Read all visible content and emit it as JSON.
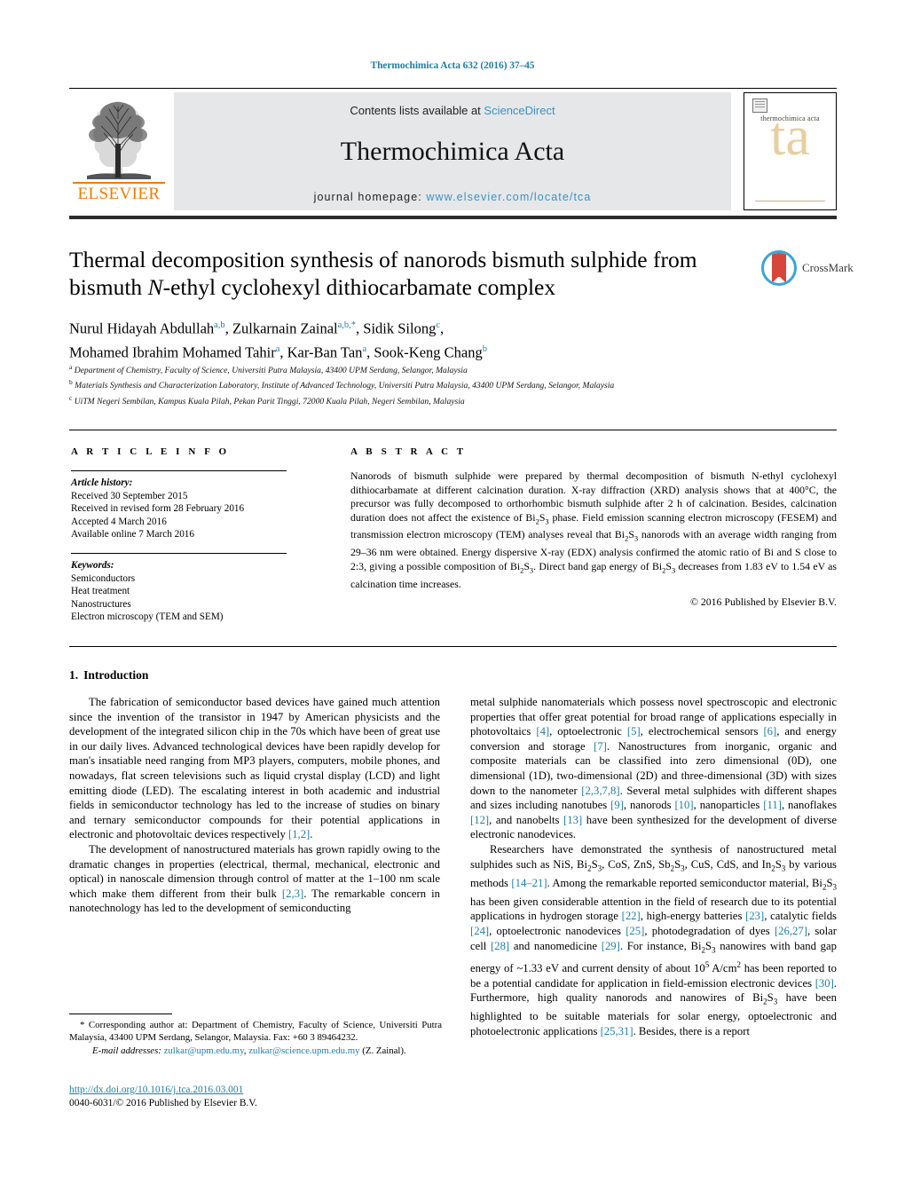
{
  "running_head": "Thermochimica Acta 632 (2016) 37–45",
  "masthead": {
    "publisher_name": "ELSEVIER",
    "contents_prefix": "Contents lists available at ",
    "contents_link": "ScienceDirect",
    "journal_name": "Thermochimica Acta",
    "homepage_label": "journal homepage: ",
    "homepage_url": "www.elsevier.com/locate/tca",
    "cover_title": "thermochimica acta",
    "cover_monogram": "ta"
  },
  "article": {
    "title_line1": "Thermal decomposition synthesis of nanorods bismuth sulphide from",
    "title_line2_pre": "bismuth ",
    "title_line2_italic": "N",
    "title_line2_post": "-ethyl cyclohexyl dithiocarbamate complex",
    "crossmark_label": "CrossMark",
    "authors": [
      {
        "name": "Nurul Hidayah Abdullah",
        "marks": "a,b",
        "sep": ", "
      },
      {
        "name": "Zulkarnain Zainal",
        "marks": "a,b,*",
        "sep": ", "
      },
      {
        "name": "Sidik Silong",
        "marks": "c",
        "sep": ","
      },
      {
        "name": "Mohamed Ibrahim Mohamed Tahir",
        "marks": "a",
        "sep": ", "
      },
      {
        "name": "Kar-Ban Tan",
        "marks": "a",
        "sep": ", "
      },
      {
        "name": "Sook-Keng Chang",
        "marks": "b",
        "sep": ""
      }
    ],
    "affiliations": [
      {
        "mark": "a",
        "text": "Department of Chemistry, Faculty of Science, Universiti Putra Malaysia, 43400 UPM Serdang, Selangor, Malaysia"
      },
      {
        "mark": "b",
        "text": "Materials Synthesis and Characterization Laboratory, Institute of Advanced Technology, Universiti Putra Malaysia, 43400 UPM Serdang, Selangor, Malaysia"
      },
      {
        "mark": "c",
        "text": "UiTM Negeri Sembilan, Kampus Kuala Pilah, Pekan Parit Tinggi, 72000 Kuala Pilah, Negeri Sembilan, Malaysia"
      }
    ]
  },
  "info": {
    "header_article_info": "A R T I C L E   I N F O",
    "header_abstract": "A B S T R A C T",
    "history_label": "Article history:",
    "history": [
      "Received 30 September 2015",
      "Received in revised form 28 February 2016",
      "Accepted 4 March 2016",
      "Available online 7 March 2016"
    ],
    "keywords_label": "Keywords:",
    "keywords": [
      "Semiconductors",
      "Heat treatment",
      "Nanostructures",
      "Electron microscopy (TEM and SEM)"
    ]
  },
  "abstract": {
    "text_part1": "Nanorods of bismuth sulphide were prepared by thermal decomposition of bismuth N-ethyl cyclohexyl dithiocarbamate at different calcination duration. X-ray diffraction (XRD) analysis shows that at 400°C, the precursor was fully decomposed to orthorhombic bismuth sulphide after 2 h of calcination. Besides, calcination duration does not affect the existence of Bi",
    "text_part2": " phase. Field emission scanning electron microscopy (FESEM) and transmission electron microscopy (TEM) analyses reveal that Bi",
    "text_part3": " nanorods with an average width ranging from 29–36 nm were obtained. Energy dispersive X-ray (EDX) analysis confirmed the atomic ratio of Bi and S close to 2:3, giving a possible composition of Bi",
    "text_part4": ". Direct band gap energy of Bi",
    "text_part5": " decreases from 1.83 eV to 1.54 eV as calcination time increases.",
    "copyright": "© 2016 Published by Elsevier B.V."
  },
  "body": {
    "section_number": "1.",
    "section_title": "Introduction",
    "left_paragraph_1": "The fabrication of semiconductor based devices have gained much attention since the invention of the transistor in 1947 by American physicists and the development of the integrated silicon chip in the 70s which have been of great use in our daily lives. Advanced technological devices have been rapidly develop for man's insatiable need ranging from MP3 players, computers, mobile phones, and nowadays, flat screen televisions such as liquid crystal display (LCD) and light emitting diode (LED). The escalating interest in both academic and industrial fields in semiconductor technology has led to the increase of studies on binary and ternary semiconductor compounds for their potential applications in electronic and photovoltaic devices respectively ",
    "left_paragraph_1_ref": "[1,2]",
    "left_paragraph_1_end": ".",
    "left_paragraph_2_a": "The development of nanostructured materials has grown rapidly owing to the dramatic changes in properties (electrical, thermal, mechanical, electronic and optical) in nanoscale dimension through control of matter at the 1–100 nm scale which make them different from their bulk ",
    "left_paragraph_2_ref": "[2,3]",
    "left_paragraph_2_b": ". The remarkable concern in nanotechnology has led to the development of semiconducting",
    "right_paragraph_1_a": "metal sulphide nanomaterials which possess novel spectroscopic and electronic properties that offer great potential for broad range of applications especially in photovoltaics ",
    "right_ref_4": "[4]",
    "right_paragraph_1_b": ", optoelectronic ",
    "right_ref_5": "[5]",
    "right_paragraph_1_c": ", electrochemical sensors ",
    "right_ref_6": "[6]",
    "right_paragraph_1_d": ", and energy conversion and storage ",
    "right_ref_7": "[7]",
    "right_paragraph_1_e": ". Nanostructures from inorganic, organic and composite materials can be classified into zero dimensional (0D), one dimensional (1D), two-dimensional (2D) and three-dimensional (3D) with sizes down to the nanometer ",
    "right_ref_2378": "[2,3,7,8]",
    "right_paragraph_1_f": ". Several metal sulphides with different shapes and sizes including nanotubes ",
    "right_ref_9": "[9]",
    "right_paragraph_1_g": ", nanorods ",
    "right_ref_10": "[10]",
    "right_paragraph_1_h": ", nanoparticles ",
    "right_ref_11": "[11]",
    "right_paragraph_1_i": ", nanoflakes ",
    "right_ref_12": "[12]",
    "right_paragraph_1_j": ", and nanobelts ",
    "right_ref_13": "[13]",
    "right_paragraph_1_k": " have been synthesized for the development of diverse electronic nanodevices.",
    "right_paragraph_2_a": "Researchers have demonstrated the synthesis of nanostructured metal sulphides such as NiS, Bi",
    "right_paragraph_2_b": ", CoS, ZnS, Sb",
    "right_paragraph_2_c": ", CuS, CdS, and In",
    "right_paragraph_2_d": " by various methods ",
    "right_ref_1421": "[14–21]",
    "right_paragraph_2_e": ". Among the remarkable reported semiconductor material, Bi",
    "right_paragraph_2_f": " has been given considerable attention in the field of research due to its potential applications in hydrogen storage ",
    "right_ref_22": "[22]",
    "right_paragraph_2_g": ", high-energy batteries ",
    "right_ref_23": "[23]",
    "right_paragraph_2_h": ", catalytic fields ",
    "right_ref_24": "[24]",
    "right_paragraph_2_i": ", optoelectronic nanodevices ",
    "right_ref_25": "[25]",
    "right_paragraph_2_j": ", photodegradation of dyes ",
    "right_ref_2627": "[26,27]",
    "right_paragraph_2_k": ", solar cell ",
    "right_ref_28": "[28]",
    "right_paragraph_2_l": " and nanomedicine ",
    "right_ref_29": "[29]",
    "right_paragraph_2_m": ". For instance, Bi",
    "right_paragraph_2_n": " nanowires with band gap energy of ~1.33 eV and current density of about 10",
    "right_paragraph_2_sup": "5",
    "right_paragraph_2_o": " A/cm",
    "right_paragraph_2_sup2": "2",
    "right_paragraph_2_p": " has been reported to be a potential candidate for application in field-emission electronic devices ",
    "right_ref_30": "[30]",
    "right_paragraph_2_q": ". Furthermore, high quality nanorods and nanowires of Bi",
    "right_paragraph_2_r": " have been highlighted to be suitable materials for solar energy, optoelectronic and photoelectronic applications ",
    "right_ref_2531": "[25,31]",
    "right_paragraph_2_s": ". Besides, there is a report"
  },
  "footnote": {
    "corresponding": "* Corresponding author at: Department of Chemistry, Faculty of Science, Universiti Putra Malaysia, 43400 UPM Serdang, Selangor, Malaysia. Fax: +60 3 89464232.",
    "email_label": "E-mail addresses:",
    "email_1": "zulkar@upm.edu.my",
    "email_2": "zulkar@science.upm.edu.my",
    "email_suffix": "(Z. Zainal)."
  },
  "doi": {
    "url": "http://dx.doi.org/10.1016/j.tca.2016.03.001",
    "issn_line": "0040-6031/© 2016 Published by Elsevier B.V."
  },
  "colors": {
    "link_blue": "#1f7fa6",
    "sd_blue": "#3a93c4",
    "elsevier_orange": "#f07d00",
    "band_gray": "#e6e7e9",
    "crossmark_blue": "#3aa6d8",
    "crossmark_red": "#d8453a",
    "cover_tan": "#e8cfa0"
  }
}
